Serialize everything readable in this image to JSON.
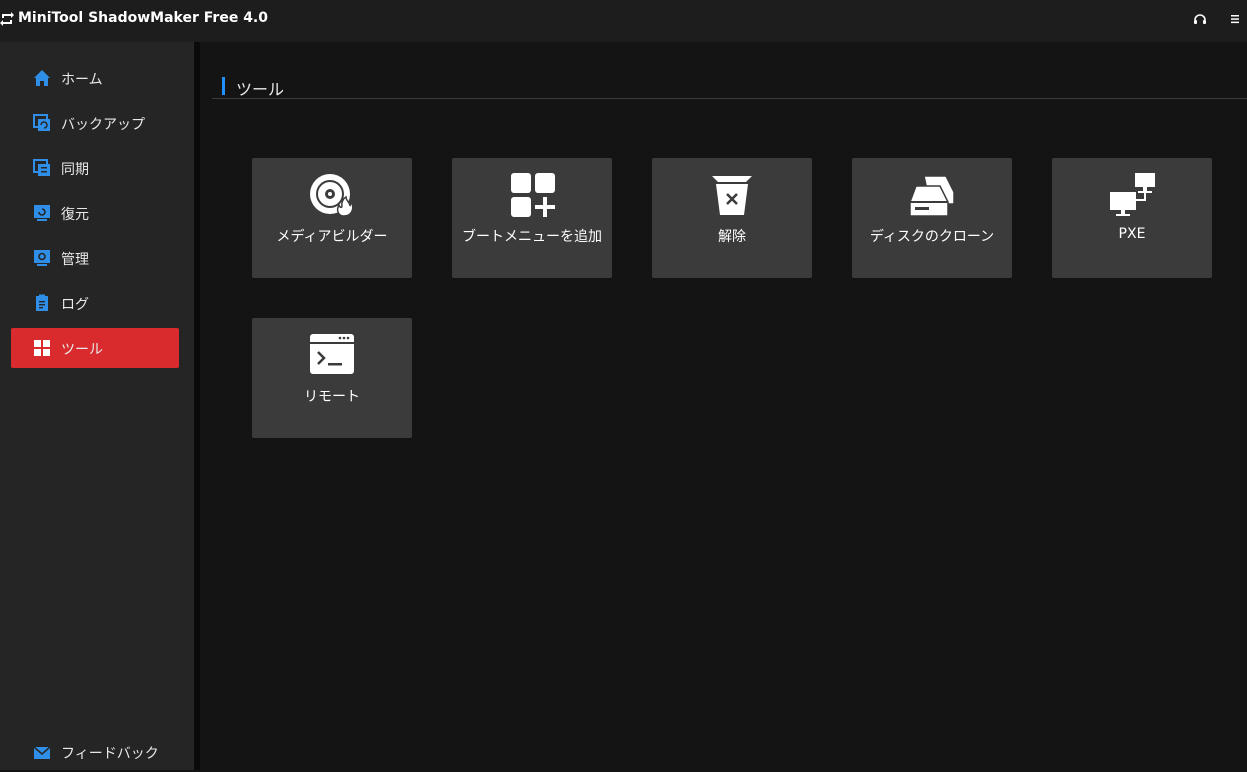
{
  "app": {
    "title": "MiniTool ShadowMaker Free 4.0"
  },
  "sidebar": {
    "items": [
      {
        "label": "ホーム",
        "icon": "home-icon"
      },
      {
        "label": "バックアップ",
        "icon": "backup-icon"
      },
      {
        "label": "同期",
        "icon": "sync-icon"
      },
      {
        "label": "復元",
        "icon": "restore-icon"
      },
      {
        "label": "管理",
        "icon": "manage-icon"
      },
      {
        "label": "ログ",
        "icon": "log-icon"
      },
      {
        "label": "ツール",
        "icon": "tools-icon",
        "active": true
      }
    ],
    "feedback": {
      "label": "フィードバック",
      "icon": "mail-icon"
    }
  },
  "main": {
    "section_title": "ツール",
    "tools": [
      {
        "label": "メディアビルダー",
        "icon": "media-builder-disc-icon"
      },
      {
        "label": "ブートメニューを追加",
        "icon": "add-boot-menu-icon"
      },
      {
        "label": "解除",
        "icon": "unmount-icon"
      },
      {
        "label": "ディスクのクローン",
        "icon": "disk-clone-icon"
      },
      {
        "label": "PXE",
        "icon": "pxe-network-icon"
      },
      {
        "label": "リモート",
        "icon": "remote-terminal-icon"
      }
    ]
  },
  "colors": {
    "accent_red": "#d92b2e",
    "accent_blue": "#1e90ff",
    "icon_blue": "#2f8fe8",
    "tile_bg": "#3b3b3b",
    "sidebar_bg": "#252525",
    "main_bg": "#141414"
  }
}
